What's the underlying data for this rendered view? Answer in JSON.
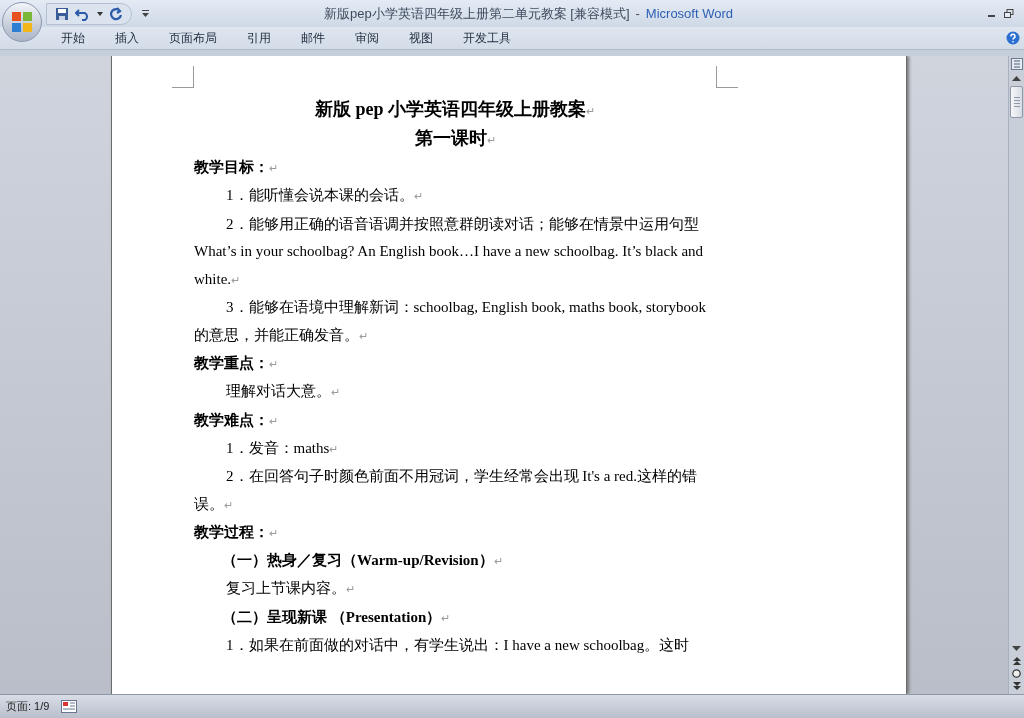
{
  "window": {
    "title": "新版pep小学英语四年级上册第二单元教案 [兼容模式]",
    "app_name": "Microsoft Word",
    "separator": "-"
  },
  "ribbon_tabs": [
    {
      "label": "开始",
      "selected": false
    },
    {
      "label": "插入",
      "selected": false
    },
    {
      "label": "页面布局",
      "selected": false
    },
    {
      "label": "引用",
      "selected": false
    },
    {
      "label": "邮件",
      "selected": false
    },
    {
      "label": "审阅",
      "selected": false
    },
    {
      "label": "视图",
      "selected": false
    },
    {
      "label": "开发工具",
      "selected": false
    }
  ],
  "document": {
    "paragraphs": [
      {
        "kind": "title",
        "text": "新版 pep 小学英语四年级上册教案",
        "end_mark": "↵"
      },
      {
        "kind": "title",
        "text": "第一课时",
        "end_mark": "↵"
      },
      {
        "kind": "section",
        "text": "教学目标：",
        "end_mark": "↵"
      },
      {
        "kind": "item",
        "text": "1．能听懂会说本课的会话。",
        "end_mark": "↵"
      },
      {
        "kind": "item",
        "text": "2．能够用正确的语音语调并按照意群朗读对话；能够在情景中运用句型 What’s in your schoolbag? An English book…I have a new schoolbag. It’s black and white.",
        "end_mark": "↵"
      },
      {
        "kind": "item",
        "text": "3．能够在语境中理解新词：schoolbag, English book, maths book, storybook 的意思，并能正确发音。",
        "end_mark": "↵"
      },
      {
        "kind": "section",
        "text": "教学重点：",
        "end_mark": "↵"
      },
      {
        "kind": "item",
        "text": "理解对话大意。",
        "end_mark": "↵"
      },
      {
        "kind": "section",
        "text": "教学难点：",
        "end_mark": "↵"
      },
      {
        "kind": "item",
        "text": "1．发音：maths",
        "end_mark": "↵"
      },
      {
        "kind": "item",
        "text": "2．在回答句子时颜色前面不用冠词，学生经常会出现 It's a red.这样的错误。",
        "end_mark": "↵"
      },
      {
        "kind": "section",
        "text": "教学过程：",
        "end_mark": "↵"
      },
      {
        "kind": "subsection",
        "text": "（一）热身／复习（Warm-up/Revision）",
        "end_mark": "↵"
      },
      {
        "kind": "item",
        "text": "复习上节课内容。",
        "end_mark": "↵"
      },
      {
        "kind": "subsection",
        "text": "（二）呈现新课 （Presentation）",
        "end_mark": "↵"
      },
      {
        "kind": "item",
        "text": "1．如果在前面做的对话中，有学生说出：I have a new schoolbag。这时"
      }
    ]
  },
  "status_bar": {
    "page": "页面: 1/9"
  }
}
